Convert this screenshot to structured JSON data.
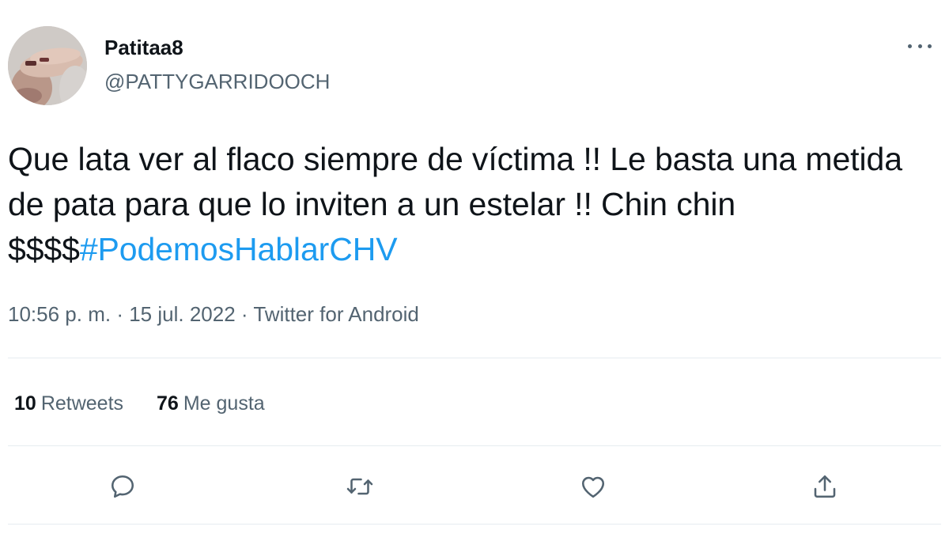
{
  "user": {
    "display_name": "Patitaa8",
    "handle": "@PATTYGARRIDOOCH"
  },
  "tweet": {
    "text": "Que lata ver al flaco siempre de víctima !! Le basta una metida de pata para que lo inviten a un estelar !! Chin chin $$$$",
    "hashtag": "#PodemosHablarCHV",
    "time": "10:56 p. m.",
    "date": "15 jul. 2022",
    "source": "Twitter for Android",
    "separator": "·"
  },
  "stats": {
    "retweets_count": "10",
    "retweets_label": "Retweets",
    "likes_count": "76",
    "likes_label": "Me gusta"
  },
  "icons": {
    "reply": "reply-icon",
    "retweet": "retweet-icon",
    "like": "heart-icon",
    "share": "share-icon",
    "more": "more-icon"
  },
  "colors": {
    "text": "#0f1419",
    "secondary": "#536471",
    "link": "#1d9bf0",
    "divider": "#e6ecf0"
  }
}
